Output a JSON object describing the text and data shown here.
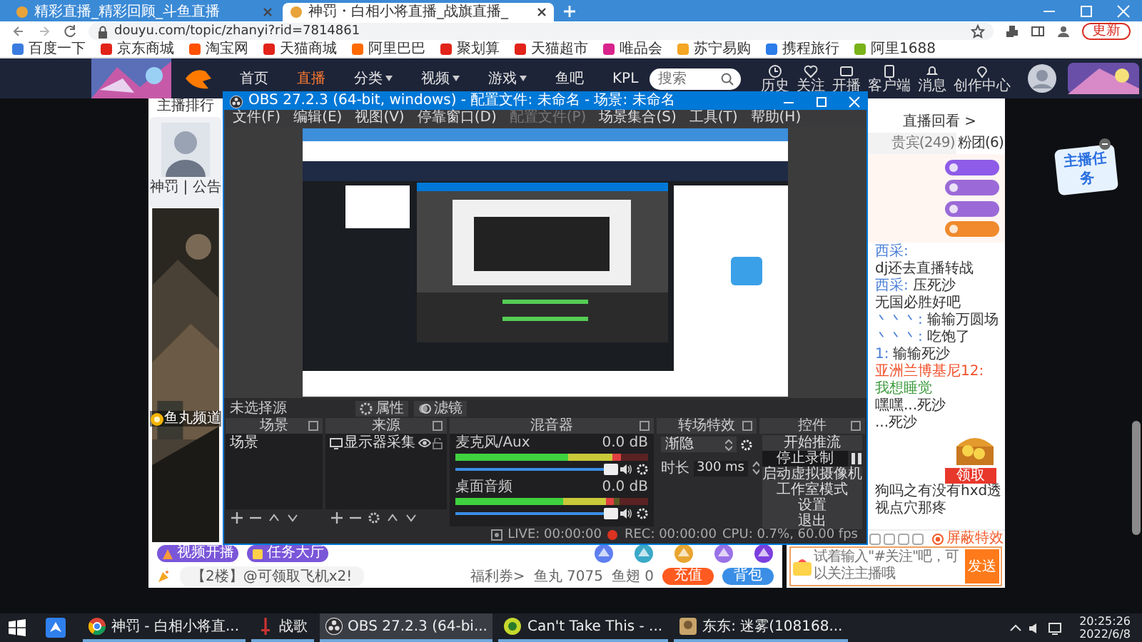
{
  "browser": {
    "tabs": [
      {
        "title": "精彩直播_精彩回顾_斗鱼直播",
        "selected": false
      },
      {
        "title": "神罚・白相小将直播_战旗直播_",
        "selected": true
      }
    ],
    "url": "douyu.com/topic/zhanyi?rid=7814861",
    "update_button": "更新",
    "bookmarks": [
      "百度一下",
      "京东商城",
      "淘宝网",
      "天猫商城",
      "阿里巴巴",
      "聚划算",
      "天猫超市",
      "唯品会",
      "苏宁易购",
      "携程旅行",
      "阿里1688"
    ]
  },
  "site_nav": {
    "items": [
      {
        "label": "首页",
        "selected": false,
        "has_menu": false
      },
      {
        "label": "直播",
        "selected": true,
        "has_menu": false
      },
      {
        "label": "分类",
        "selected": false,
        "has_menu": true
      },
      {
        "label": "视频",
        "selected": false,
        "has_menu": true
      },
      {
        "label": "游戏",
        "selected": false,
        "has_menu": true
      },
      {
        "label": "鱼吧",
        "selected": false,
        "has_menu": false
      },
      {
        "label": "KPL",
        "selected": false,
        "has_menu": false
      }
    ],
    "search_placeholder": "搜索",
    "tools": [
      "历史",
      "关注",
      "开播",
      "客户端",
      "消息",
      "创作中心"
    ]
  },
  "page_top": {
    "rank": "主播排行"
  },
  "streamer": {
    "name": "神罚 | 公告",
    "channel_label": "鱼丸频道"
  },
  "sticker": "主播任务",
  "obs": {
    "title": "OBS 27.2.3 (64-bit, windows) - 配置文件: 未命名 - 场景: 未命名",
    "menu": [
      {
        "label": "文件(F)",
        "disabled": false
      },
      {
        "label": "编辑(E)",
        "disabled": false
      },
      {
        "label": "视图(V)",
        "disabled": false
      },
      {
        "label": "停靠窗口(D)",
        "disabled": false
      },
      {
        "label": "配置文件(P)",
        "disabled": true
      },
      {
        "label": "场景集合(S)",
        "disabled": false
      },
      {
        "label": "工具(T)",
        "disabled": false
      },
      {
        "label": "帮助(H)",
        "disabled": false
      }
    ],
    "source_bar": {
      "label": "未选择源",
      "buttons": [
        "属性",
        "滤镜"
      ]
    },
    "scenes": {
      "title": "场景",
      "items": [
        {
          "label": "场景",
          "selected": false
        }
      ]
    },
    "sources": {
      "title": "来源",
      "items": [
        {
          "label": "显示器采集",
          "visible": true,
          "locked": false
        }
      ]
    },
    "mixer": {
      "title": "混音器",
      "channels": [
        {
          "name": "麦克风/Aux",
          "reading": "0.0 dB",
          "meter": {
            "level": 0.86
          },
          "volume": {
            "level": 0.97
          }
        },
        {
          "name": "桌面音频",
          "reading": "0.0 dB",
          "meter": {
            "level": 0.82
          },
          "volume": {
            "level": 0.97
          }
        }
      ]
    },
    "transitions": {
      "title": "转场特效",
      "type": "渐隐",
      "duration_label": "时长",
      "duration": "300 ms"
    },
    "controls": {
      "title": "控件",
      "buttons": [
        {
          "label": "开始推流",
          "active": false
        },
        {
          "label": "停止录制",
          "active": true
        },
        {
          "label": "启动虚拟摄像机",
          "active": false
        },
        {
          "label": "工作室模式",
          "active": false
        },
        {
          "label": "设置",
          "active": false
        },
        {
          "label": "退出",
          "active": false
        }
      ]
    },
    "status": {
      "live": "LIVE: 00:00:00",
      "rec": "REC: 00:00:00",
      "cpu": "CPU: 0.7%, 60.00 fps"
    }
  },
  "chat": {
    "replay": "直播回看 >",
    "tabs": [
      {
        "label": "贵宾(249)",
        "selected": false
      },
      {
        "label": "粉团(6)",
        "selected": true
      }
    ],
    "messages": [
      {
        "user": "西采:",
        "text": "dj还去直播转战",
        "kind": "normal"
      },
      {
        "user": "西采:",
        "text": "压死沙",
        "kind": "normal"
      },
      {
        "text": "无国必胜好吧",
        "kind": "normal"
      },
      {
        "user": "丶丶丶:",
        "text": "输输万圆场",
        "kind": "normal"
      },
      {
        "user": "丶丶丶:",
        "text": "吃饱了",
        "kind": "normal"
      },
      {
        "user": "1:",
        "text": "输输死沙",
        "kind": "normal"
      },
      {
        "user": "亚洲兰博基尼12:",
        "text": "我想睡觉",
        "kind": "highlight"
      },
      {
        "text": "嘿嘿...死沙",
        "kind": "normal"
      },
      {
        "text": "...死沙",
        "kind": "normal"
      }
    ],
    "chest_button": "领取",
    "last_message": "狗吗之有没有hxd透视点穴那疼",
    "shield": "屏蔽特效",
    "input_placeholder": "试着输入\"#关注\"吧，可以关注主播哦",
    "send": "发送"
  },
  "page_bottom": {
    "shortcuts": [
      "视频开播",
      "任务大厅"
    ],
    "notice": "【2楼】@可领取飞机x2!",
    "welfare": "福利券>",
    "fish_ball": "鱼丸 7075",
    "fish_fin": "鱼翅 0",
    "recharge": "充值",
    "backpack": "背包"
  },
  "taskbar": {
    "items": [
      {
        "kind": "chrome",
        "label": "神罚 - 白相小将直...",
        "selected": false
      },
      {
        "kind": "game",
        "label": "战歌",
        "selected": false
      },
      {
        "kind": "obs",
        "label": "OBS 27.2.3 (64-bi...",
        "selected": true
      },
      {
        "kind": "music",
        "label": "Can't Take This - ...",
        "selected": false
      },
      {
        "kind": "chat",
        "label": "东东: 迷雾(108168...",
        "selected": false
      }
    ],
    "time": "20:25:26",
    "date": "2022/6/8"
  }
}
